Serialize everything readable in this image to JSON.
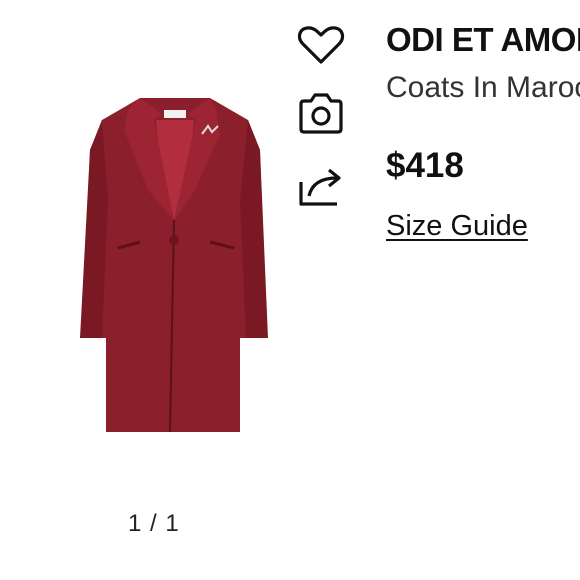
{
  "product": {
    "brand": "ODI ET AMOR",
    "subtitle": "Coats In Maroon",
    "price": "$418",
    "size_guide": "Size Guide"
  },
  "gallery": {
    "pager": "1 / 1",
    "image": {
      "depicts": "maroon single-breasted coat",
      "color": "#8c1f2c"
    }
  },
  "actions": {
    "icons": [
      "heart-icon",
      "camera-icon",
      "share-icon"
    ]
  }
}
